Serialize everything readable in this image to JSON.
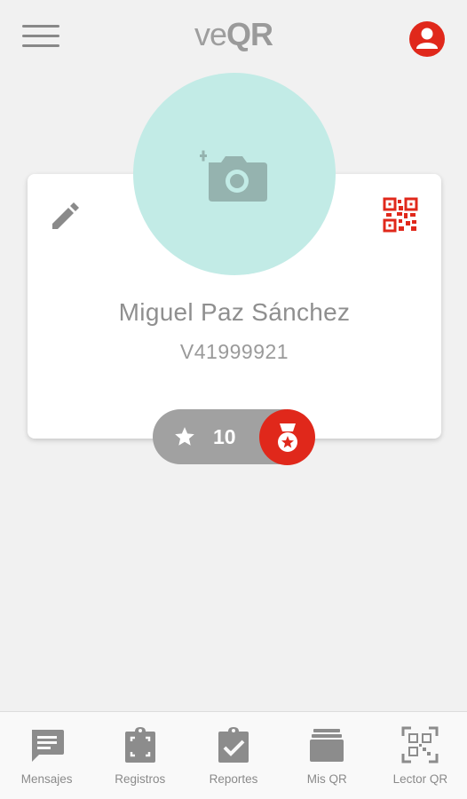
{
  "header": {
    "logo_prefix": "ve",
    "logo_suffix": "QR",
    "icons": {
      "menu": "hamburger-icon",
      "user": "account-circle-icon"
    },
    "accent_color": "#e0281b"
  },
  "avatar": {
    "icon": "add-photo-icon",
    "bg_color": "#c2ebe6"
  },
  "profile": {
    "name": "Miguel Paz Sánchez",
    "doc_id": "V41999921",
    "edit_icon": "pencil-icon",
    "qr_icon": "qr-code-icon"
  },
  "points": {
    "value": "10",
    "star_icon": "star-icon",
    "medal_icon": "medal-icon"
  },
  "bottom_nav": [
    {
      "label": "Mensajes",
      "icon": "message-icon"
    },
    {
      "label": "Registros",
      "icon": "clipboard-scan-icon"
    },
    {
      "label": "Reportes",
      "icon": "clipboard-check-icon"
    },
    {
      "label": "Mis QR",
      "icon": "wallet-icon"
    },
    {
      "label": "Lector QR",
      "icon": "qr-scanner-icon"
    }
  ]
}
